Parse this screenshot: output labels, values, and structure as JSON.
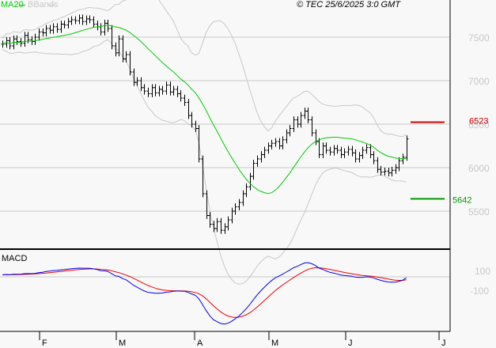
{
  "legend": {
    "ma": "MA20",
    "bb": "BBands",
    "ma_color": "#00cc00",
    "bb_color": "#c8c8c8"
  },
  "copyright": "© TEC 25/6/2025 3:0 GMT",
  "macd_label": "MACD",
  "markers": {
    "resistance": {
      "value": 6523,
      "label": "6523",
      "color": "#cc0000"
    },
    "support": {
      "value": 5642,
      "label": "5642",
      "color": "#009900"
    }
  },
  "chart_data": {
    "type": "line",
    "title": "",
    "price_axis": {
      "ticks": [
        5500,
        6000,
        6500,
        7000,
        7500
      ],
      "labels": [
        "5500",
        "6000",
        "6500",
        "7000",
        "7500"
      ]
    },
    "macd_axis": {
      "ticks": [
        100,
        -100
      ],
      "labels": [
        "100",
        "-100"
      ]
    },
    "month_labels": [
      "F",
      "M",
      "A",
      "M",
      "J",
      "J"
    ],
    "closes": [
      7420,
      7460,
      7400,
      7480,
      7450,
      7430,
      7520,
      7470,
      7450,
      7500,
      7560,
      7550,
      7600,
      7580,
      7620,
      7590,
      7650,
      7640,
      7680,
      7700,
      7690,
      7720,
      7680,
      7710,
      7700,
      7650,
      7620,
      7560,
      7660,
      7600,
      7400,
      7320,
      7480,
      7250,
      7300,
      7100,
      6980,
      7000,
      6920,
      6880,
      6850,
      6920,
      6860,
      6900,
      6880,
      6950,
      6870,
      6900,
      6850,
      6800,
      6750,
      6600,
      6500,
      6450,
      6100,
      5700,
      5450,
      5350,
      5300,
      5380,
      5280,
      5320,
      5400,
      5500,
      5550,
      5600,
      5700,
      5780,
      5900,
      6050,
      6100,
      6150,
      6200,
      6250,
      6280,
      6300,
      6250,
      6320,
      6400,
      6450,
      6550,
      6500,
      6600,
      6650,
      6550,
      6400,
      6300,
      6150,
      6250,
      6200,
      6180,
      6220,
      6200,
      6150,
      6180,
      6210,
      6170,
      6100,
      6140,
      6200,
      6230,
      6150,
      6080,
      5980,
      5950,
      5960,
      5940,
      5970,
      6000,
      6080,
      6120,
      6330
    ],
    "series": [
      {
        "name": "MA20",
        "color": "#00cc00"
      },
      {
        "name": "BBands",
        "color": "#c8c8c8"
      },
      {
        "name": "MACD",
        "color": "#0000ee"
      },
      {
        "name": "Signal",
        "color": "#ee0000"
      }
    ]
  }
}
